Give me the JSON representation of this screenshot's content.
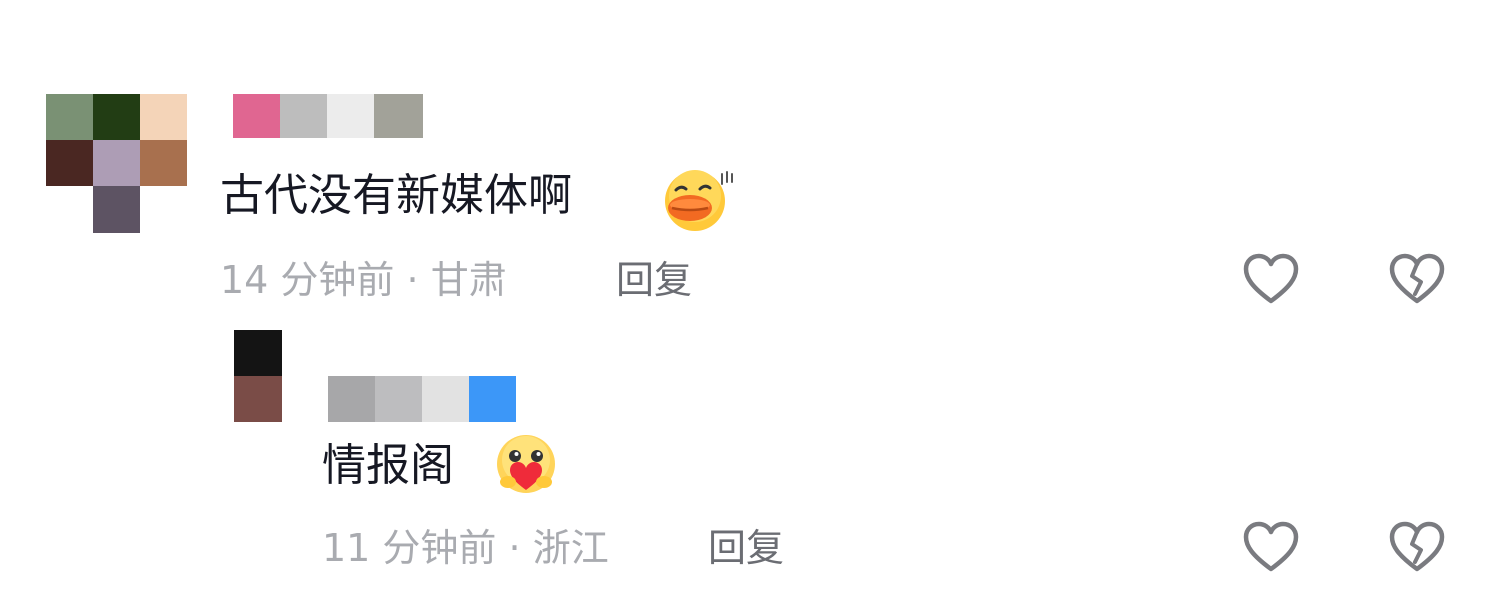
{
  "comments": [
    {
      "text": "古代没有新媒体啊",
      "time": "14 分钟前",
      "sep": "·",
      "location": "甘肃",
      "reply_label": "回复",
      "emoji": "duck-lips-emoji",
      "avatar_colors": [
        "#7a9174",
        "#223d14",
        "#f4d4b8",
        "#4a2722",
        "#ad9db5",
        "#a8704e",
        "#5d5363"
      ],
      "name_blur_colors": [
        "#e06691",
        "#bdbdbd",
        "#ececec",
        "#a2a299"
      ]
    },
    {
      "text": "情报阁",
      "time": "11 分钟前",
      "sep": "·",
      "location": "浙江",
      "reply_label": "回复",
      "emoji": "heart-hug-emoji",
      "avatar_colors": [
        "#141414",
        "#7a4c47"
      ],
      "name_blur_colors": [
        "#a7a7a9",
        "#bdbdbf",
        "#e2e2e2",
        "#3c97f8"
      ]
    }
  ],
  "icons": [
    "like-heart-icon",
    "dislike-broken-heart-icon"
  ]
}
